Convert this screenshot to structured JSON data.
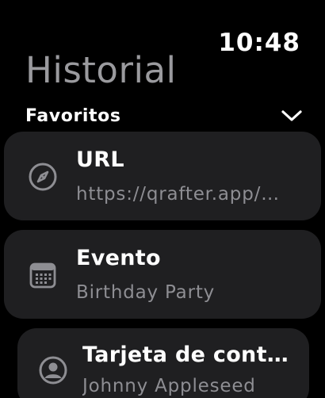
{
  "status_bar": {
    "time": "10:48"
  },
  "header": {
    "title": "Historial"
  },
  "section": {
    "label": "Favoritos",
    "chevron_icon": "chevron-down-icon"
  },
  "items": [
    {
      "title": "URL",
      "subtitle": "https://qrafter.app/…",
      "icon": "compass-icon"
    },
    {
      "title": "Evento",
      "subtitle": "Birthday Party",
      "icon": "calendar-icon"
    },
    {
      "title": "Tarjeta de cont…",
      "subtitle": "Johnny Appleseed",
      "icon": "person-circle-icon"
    }
  ],
  "colors": {
    "background": "#000000",
    "card": "#1f1f21",
    "title_gray": "#9a9a9e",
    "subtitle_gray": "#8e8e93",
    "icon_gray": "#8e8e93"
  }
}
